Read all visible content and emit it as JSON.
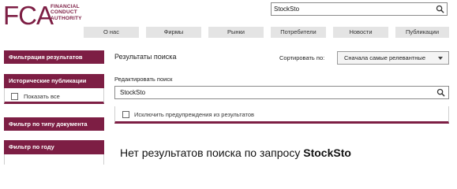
{
  "brand": {
    "mark": "FCA",
    "name_lines": [
      "FINANCIAL",
      "CONDUCT",
      "AUTHORITY"
    ],
    "color": "#7d1e44"
  },
  "header_search": {
    "value": "StockSto",
    "icon": "search-icon"
  },
  "nav": {
    "items": [
      "О нас",
      "Фирмы",
      "Рынки",
      "Потребители",
      "Новости",
      "Публикации"
    ]
  },
  "sidebar": {
    "filter_results": "Фильтрация результатов",
    "historical": "Исторические публикации",
    "show_all": "Показать все",
    "show_all_checked": false,
    "filter_doc_type": "Фильтр по типу документа",
    "filter_year": "Фильтр по году"
  },
  "main": {
    "results_title": "Результаты поиска",
    "sort_label": "Сортировать по:",
    "sort_value": "Сначала самые релевантные",
    "edit_label": "Редактировать поиск",
    "search_value": "StockSto",
    "exclude_warnings": "Исключить предупреждения из результатов",
    "exclude_checked": false,
    "no_results_prefix": "Нет результатов поиска по запросу",
    "no_results_query": "StockSto"
  }
}
